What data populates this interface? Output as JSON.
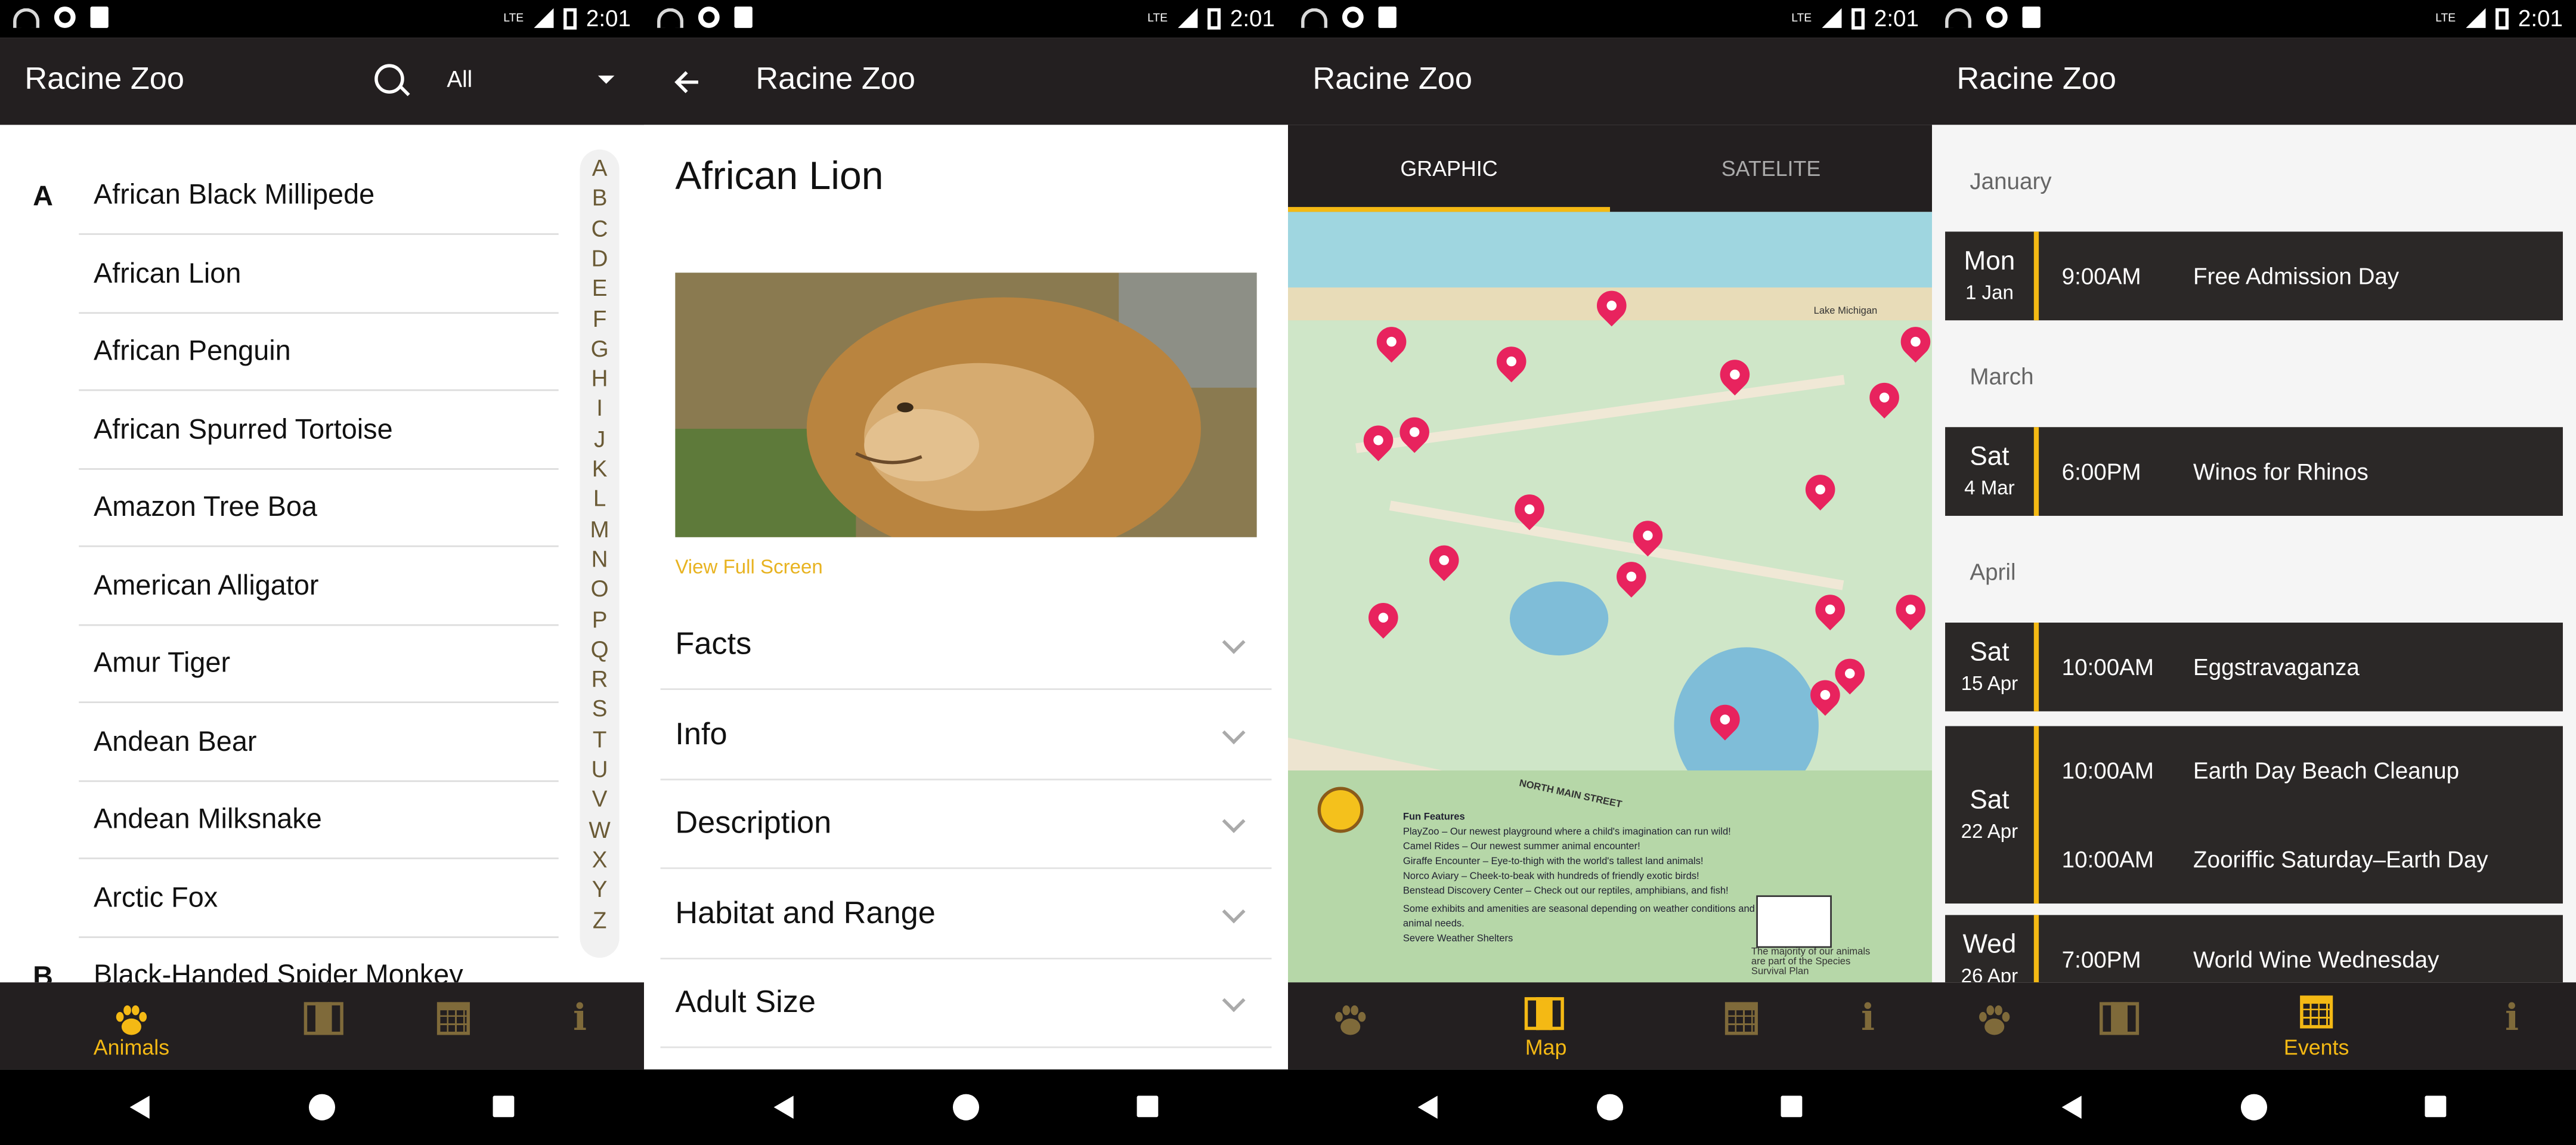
{
  "status": {
    "time": "2:01",
    "lte": "LTE"
  },
  "app_title": "Racine Zoo",
  "nav": {
    "animals": "Animals",
    "map": "Map",
    "events": "Events"
  },
  "animals_panel": {
    "filter_value": "All",
    "groups": [
      {
        "letter": "A",
        "items": [
          "African Black Millipede",
          "African Lion",
          "African Penguin",
          "African Spurred Tortoise",
          "Amazon Tree Boa",
          "American Alligator",
          "Amur Tiger",
          "Andean Bear",
          "Andean Milksnake",
          "Arctic Fox"
        ]
      },
      {
        "letter": "B",
        "items": [
          "Black-Handed Spider Monkey"
        ]
      }
    ],
    "index": [
      "A",
      "B",
      "C",
      "D",
      "E",
      "F",
      "G",
      "H",
      "I",
      "J",
      "K",
      "L",
      "M",
      "N",
      "O",
      "P",
      "Q",
      "R",
      "S",
      "T",
      "U",
      "V",
      "W",
      "X",
      "Y",
      "Z"
    ]
  },
  "detail_panel": {
    "animal": "African Lion",
    "view_full_screen": "View Full Screen",
    "sections": [
      "Facts",
      "Info",
      "Description",
      "Habitat and Range",
      "Adult Size"
    ]
  },
  "map_panel": {
    "tabs": [
      "GRAPHIC",
      "SATELITE"
    ],
    "active_tab": "GRAPHIC",
    "labels": {
      "street": "NORTH MAIN STREET",
      "lake": "Lake Michigan"
    },
    "legend": {
      "title": "Fun Features",
      "items": [
        "PlayZoo – Our newest playground where a child's imagination can run wild!",
        "Camel Rides – Our newest summer animal encounter!",
        "Giraffe Encounter – Eye-to-thigh with the world's tallest land animals!",
        "Norco Aviary – Cheek-to-beak with hundreds of friendly exotic birds!",
        "Benstead Discovery Center – Check out our reptiles, amphibians, and fish!"
      ],
      "note": "Some exhibits and amenities are seasonal depending on weather conditions and animal needs.",
      "shelter": "Severe Weather Shelters"
    },
    "ssp_note": "The majority of our animals are part of the Species Survival Plan"
  },
  "events_panel": {
    "months": [
      "January",
      "March",
      "April"
    ],
    "events": [
      {
        "dow": "Mon",
        "dm": "1 Jan",
        "rows": [
          {
            "time": "9:00AM",
            "name": "Free Admission Day"
          }
        ]
      },
      {
        "dow": "Sat",
        "dm": "4 Mar",
        "rows": [
          {
            "time": "6:00PM",
            "name": "Winos for Rhinos"
          }
        ]
      },
      {
        "dow": "Sat",
        "dm": "15 Apr",
        "rows": [
          {
            "time": "10:00AM",
            "name": "Eggstravaganza"
          }
        ]
      },
      {
        "dow": "Sat",
        "dm": "22 Apr",
        "rows": [
          {
            "time": "10:00AM",
            "name": "Earth Day Beach Cleanup"
          },
          {
            "time": "10:00AM",
            "name": "Zooriffic Saturday–Earth Day"
          }
        ]
      },
      {
        "dow": "Wed",
        "dm": "26 Apr",
        "rows": [
          {
            "time": "7:00PM",
            "name": "World Wine Wednesday"
          }
        ]
      }
    ]
  },
  "colors": {
    "accent": "#f4b914",
    "appbar": "#231f20",
    "pin": "#e8235e",
    "link": "#e8b321"
  }
}
